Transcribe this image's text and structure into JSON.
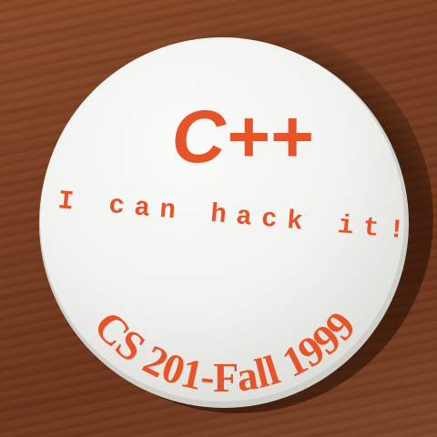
{
  "button": {
    "title": "C++",
    "tagline": "I can hack it!",
    "course": "CS 201-Fall 1999"
  },
  "colors": {
    "text": "#e8542a",
    "face": "#f3f3f1",
    "edge": "#d8d8d4",
    "table": "#7a3e22"
  }
}
